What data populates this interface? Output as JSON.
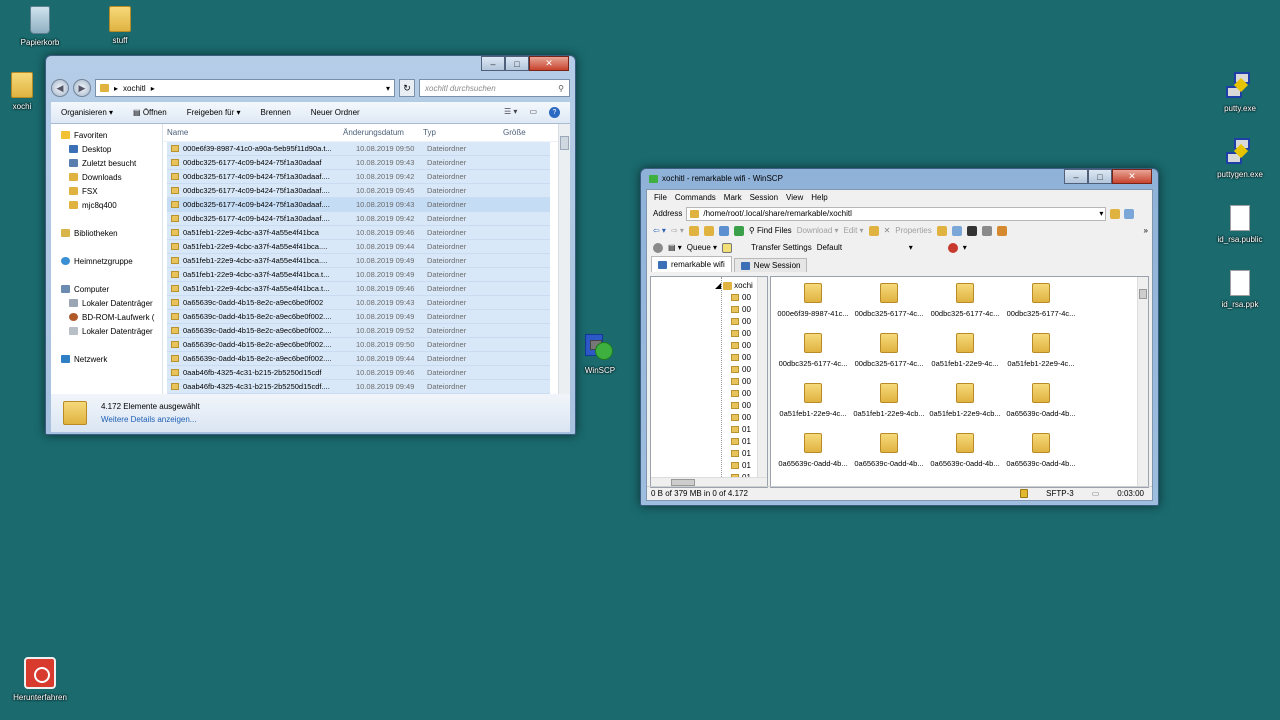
{
  "desktop": {
    "icons": [
      {
        "label": "Papierkorb"
      },
      {
        "label": "stuff"
      },
      {
        "label": "xochi"
      },
      {
        "label": "WinSCP"
      },
      {
        "label": "putty.exe"
      },
      {
        "label": "puttygen.exe"
      },
      {
        "label": "id_rsa.public"
      },
      {
        "label": "id_rsa.ppk"
      },
      {
        "label": "Herunterfahren"
      }
    ]
  },
  "explorer": {
    "breadcrumb": "xochitl",
    "search_placeholder": "xochitl durchsuchen",
    "toolbar": {
      "organize": "Organisieren ▾",
      "open": "Öffnen",
      "share": "Freigeben für ▾",
      "burn": "Brennen",
      "new_folder": "Neuer Ordner"
    },
    "nav": {
      "favorites": "Favoriten",
      "desktop": "Desktop",
      "recent": "Zuletzt besucht",
      "downloads": "Downloads",
      "fsx": "FSX",
      "mjc": "mjc8q400",
      "libraries": "Bibliotheken",
      "homegroup": "Heimnetzgruppe",
      "computer": "Computer",
      "local_disk": "Lokaler Datenträger",
      "bdrom": "BD-ROM-Laufwerk (",
      "local_disk2": "Lokaler Datenträger",
      "network": "Netzwerk"
    },
    "columns": {
      "name": "Name",
      "date": "Änderungsdatum",
      "type": "Typ",
      "size": "Größe"
    },
    "rows": [
      {
        "name": "000e6f39-8987-41c0-a90a-5eb95f11d90a.t...",
        "date": "10.08.2019 09:50",
        "type": "Dateiordner"
      },
      {
        "name": "00dbc325-6177-4c09-b424-75f1a30adaaf",
        "date": "10.08.2019 09:43",
        "type": "Dateiordner"
      },
      {
        "name": "00dbc325-6177-4c09-b424-75f1a30adaaf....",
        "date": "10.08.2019 09:42",
        "type": "Dateiordner"
      },
      {
        "name": "00dbc325-6177-4c09-b424-75f1a30adaaf....",
        "date": "10.08.2019 09:45",
        "type": "Dateiordner"
      },
      {
        "name": "00dbc325-6177-4c09-b424-75f1a30adaaf....",
        "date": "10.08.2019 09:43",
        "type": "Dateiordner"
      },
      {
        "name": "00dbc325-6177-4c09-b424-75f1a30adaaf....",
        "date": "10.08.2019 09:42",
        "type": "Dateiordner"
      },
      {
        "name": "0a51feb1-22e9-4cbc-a37f-4a55e4f41bca",
        "date": "10.08.2019 09:46",
        "type": "Dateiordner"
      },
      {
        "name": "0a51feb1-22e9-4cbc-a37f-4a55e4f41bca....",
        "date": "10.08.2019 09:44",
        "type": "Dateiordner"
      },
      {
        "name": "0a51feb1-22e9-4cbc-a37f-4a55e4f41bca....",
        "date": "10.08.2019 09:49",
        "type": "Dateiordner"
      },
      {
        "name": "0a51feb1-22e9-4cbc-a37f-4a55e4f41bca.t...",
        "date": "10.08.2019 09:49",
        "type": "Dateiordner"
      },
      {
        "name": "0a51feb1-22e9-4cbc-a37f-4a55e4f41bca.t...",
        "date": "10.08.2019 09:46",
        "type": "Dateiordner"
      },
      {
        "name": "0a65639c-0add-4b15-8e2c-a9ec6be0f002",
        "date": "10.08.2019 09:43",
        "type": "Dateiordner"
      },
      {
        "name": "0a65639c-0add-4b15-8e2c-a9ec6be0f002....",
        "date": "10.08.2019 09:49",
        "type": "Dateiordner"
      },
      {
        "name": "0a65639c-0add-4b15-8e2c-a9ec6be0f002....",
        "date": "10.08.2019 09:52",
        "type": "Dateiordner"
      },
      {
        "name": "0a65639c-0add-4b15-8e2c-a9ec6be0f002....",
        "date": "10.08.2019 09:50",
        "type": "Dateiordner"
      },
      {
        "name": "0a65639c-0add-4b15-8e2c-a9ec6be0f002....",
        "date": "10.08.2019 09:44",
        "type": "Dateiordner"
      },
      {
        "name": "0aab46fb-4325-4c31-b215-2b5250d15cdf",
        "date": "10.08.2019 09:46",
        "type": "Dateiordner"
      },
      {
        "name": "0aab46fb-4325-4c31-b215-2b5250d15cdf....",
        "date": "10.08.2019 09:49",
        "type": "Dateiordner"
      }
    ],
    "status": {
      "count": "4.172 Elemente ausgewählt",
      "details": "Weitere Details anzeigen..."
    }
  },
  "winscp": {
    "title": "xochitl - remarkable wifi - WinSCP",
    "menu": [
      "File",
      "Commands",
      "Mark",
      "Session",
      "View",
      "Help"
    ],
    "address_label": "Address",
    "address_value": "/home/root/.local/share/remarkable/xochitl",
    "toolbar": {
      "find": "Find Files",
      "download": "Download",
      "edit": "Edit",
      "properties": "Properties",
      "queue": "Queue",
      "transfer_settings": "Transfer Settings",
      "transfer_default": "Default"
    },
    "tabs": {
      "session": "remarkable wifi",
      "new_session": "New Session"
    },
    "tree": {
      "root": "xochi",
      "items": [
        "00",
        "00",
        "00",
        "00",
        "00",
        "00",
        "00",
        "00",
        "00",
        "00",
        "00",
        "01",
        "01",
        "01",
        "01",
        "01"
      ]
    },
    "files": [
      "000e6f39-8987-41c...",
      "00dbc325-6177-4c...",
      "00dbc325-6177-4c...",
      "00dbc325-6177-4c...",
      "00dbc325-6177-4c...",
      "00dbc325-6177-4c...",
      "0a51feb1-22e9-4c...",
      "0a51feb1-22e9-4c...",
      "0a51feb1-22e9-4c...",
      "0a51feb1-22e9-4cb...",
      "0a51feb1-22e9-4cb...",
      "0a65639c-0add-4b...",
      "0a65639c-0add-4b...",
      "0a65639c-0add-4b...",
      "0a65639c-0add-4b...",
      "0a65639c-0add-4b..."
    ],
    "status": {
      "sel": "0 B of 379 MB in 0 of 4.172",
      "proto": "SFTP-3",
      "time": "0:03:00"
    }
  }
}
